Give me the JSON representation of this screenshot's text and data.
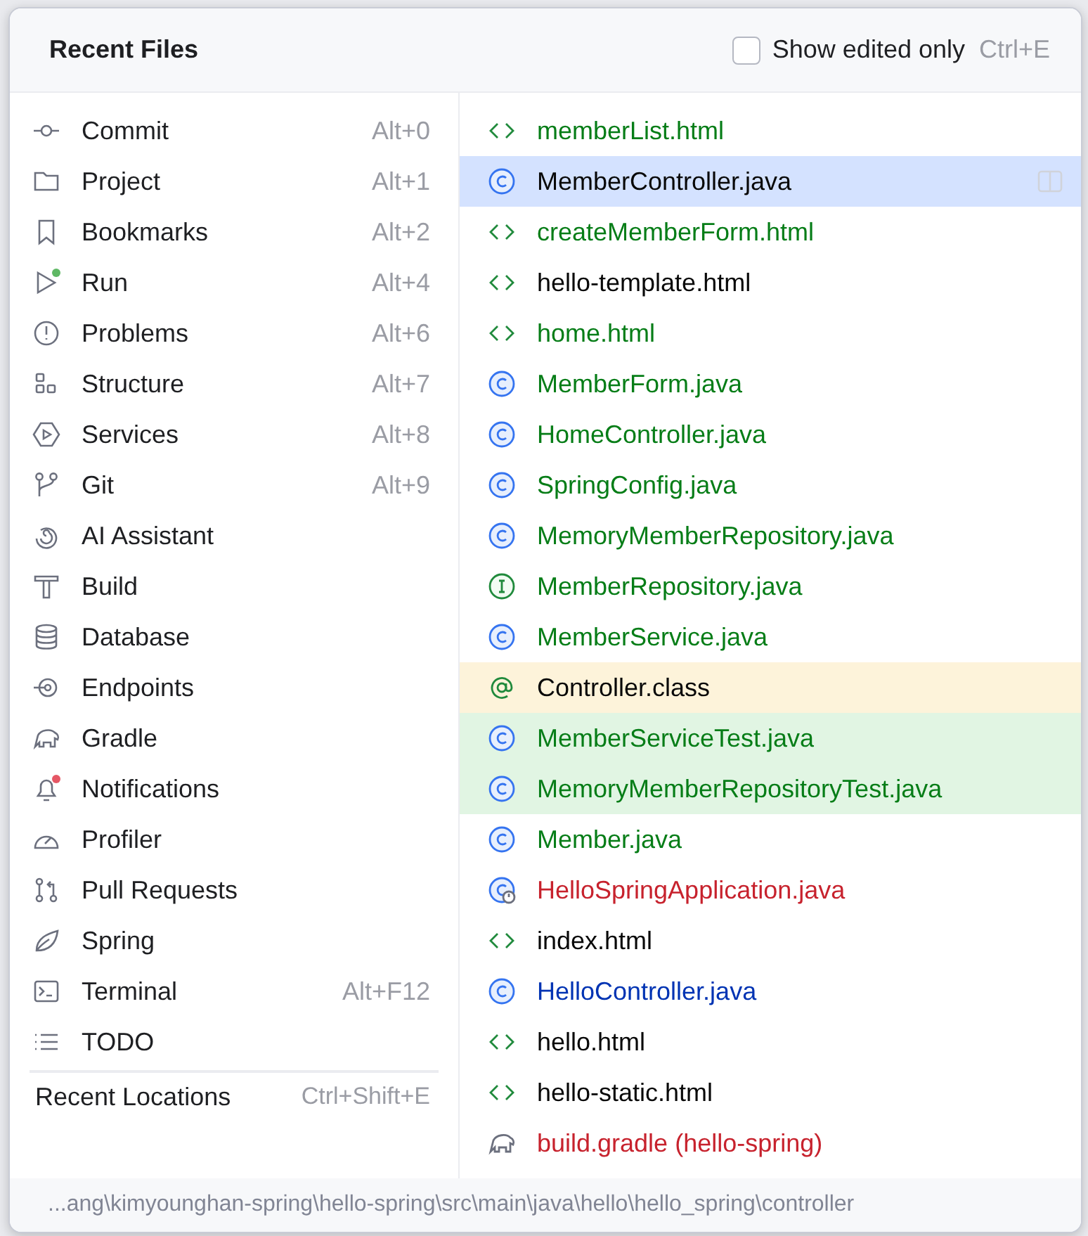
{
  "popup": {
    "title": "Recent Files",
    "show_edited_only": {
      "label": "Show edited only",
      "checked": false,
      "shortcut": "Ctrl+E"
    }
  },
  "tool_windows": [
    {
      "kind": "commit",
      "label": "Commit",
      "shortcut": "Alt+0"
    },
    {
      "kind": "folder",
      "label": "Project",
      "shortcut": "Alt+1"
    },
    {
      "kind": "bookmark",
      "label": "Bookmarks",
      "shortcut": "Alt+2"
    },
    {
      "kind": "run",
      "label": "Run",
      "shortcut": "Alt+4",
      "color": "#5fb865"
    },
    {
      "kind": "problems",
      "label": "Problems",
      "shortcut": "Alt+6"
    },
    {
      "kind": "structure",
      "label": "Structure",
      "shortcut": "Alt+7"
    },
    {
      "kind": "services",
      "label": "Services",
      "shortcut": "Alt+8"
    },
    {
      "kind": "git",
      "label": "Git",
      "shortcut": "Alt+9"
    },
    {
      "kind": "spiral",
      "label": "AI Assistant"
    },
    {
      "kind": "hammer",
      "label": "Build"
    },
    {
      "kind": "database",
      "label": "Database"
    },
    {
      "kind": "endpoints",
      "label": "Endpoints"
    },
    {
      "kind": "elephant",
      "label": "Gradle"
    },
    {
      "kind": "bell",
      "label": "Notifications",
      "color": "#e55765"
    },
    {
      "kind": "gauge",
      "label": "Profiler"
    },
    {
      "kind": "pull",
      "label": "Pull Requests"
    },
    {
      "kind": "leaf",
      "label": "Spring"
    },
    {
      "kind": "terminal",
      "label": "Terminal",
      "shortcut": "Alt+F12"
    },
    {
      "kind": "list",
      "label": "TODO"
    }
  ],
  "recent_locations": {
    "label": "Recent Locations",
    "shortcut": "Ctrl+Shift+E"
  },
  "files": [
    {
      "kind": "html",
      "name": "memberList.html",
      "color": "#067d17",
      "selected": false
    },
    {
      "kind": "class",
      "name": "MemberController.java",
      "color": "#080808",
      "selected": true
    },
    {
      "kind": "html",
      "name": "createMemberForm.html",
      "color": "#067d17",
      "selected": false
    },
    {
      "kind": "html",
      "name": "hello-template.html",
      "color": "#080808",
      "selected": false
    },
    {
      "kind": "html",
      "name": "home.html",
      "color": "#067d17",
      "selected": false
    },
    {
      "kind": "class",
      "name": "MemberForm.java",
      "color": "#067d17",
      "selected": false
    },
    {
      "kind": "class",
      "name": "HomeController.java",
      "color": "#067d17",
      "selected": false
    },
    {
      "kind": "class",
      "name": "SpringConfig.java",
      "color": "#067d17",
      "selected": false
    },
    {
      "kind": "class",
      "name": "MemoryMemberRepository.java",
      "color": "#067d17",
      "selected": false
    },
    {
      "kind": "interface",
      "name": "MemberRepository.java",
      "color": "#067d17",
      "selected": false
    },
    {
      "kind": "class",
      "name": "MemberService.java",
      "color": "#067d17",
      "selected": false
    },
    {
      "kind": "annotation",
      "name": "Controller.class",
      "color": "#080808",
      "selected": false,
      "library": true
    },
    {
      "kind": "class",
      "name": "MemberServiceTest.java",
      "color": "#067d17",
      "selected": false,
      "test": true
    },
    {
      "kind": "class",
      "name": "MemoryMemberRepositoryTest.java",
      "color": "#067d17",
      "selected": false,
      "test": true
    },
    {
      "kind": "class",
      "name": "Member.java",
      "color": "#067d17",
      "selected": false
    },
    {
      "kind": "boot",
      "name": "HelloSpringApplication.java",
      "color": "#c7222d",
      "selected": false
    },
    {
      "kind": "html",
      "name": "index.html",
      "color": "#080808",
      "selected": false
    },
    {
      "kind": "class",
      "name": "HelloController.java",
      "color": "#0033b3",
      "selected": false
    },
    {
      "kind": "html",
      "name": "hello.html",
      "color": "#080808",
      "selected": false
    },
    {
      "kind": "html",
      "name": "hello-static.html",
      "color": "#080808",
      "selected": false
    },
    {
      "kind": "gradle",
      "name": "build.gradle (hello-spring)",
      "color": "#c7222d",
      "selected": false
    }
  ],
  "path": "...ang\\kimyounghan-spring\\hello-spring\\src\\main\\java\\hello\\hello_spring\\controller"
}
